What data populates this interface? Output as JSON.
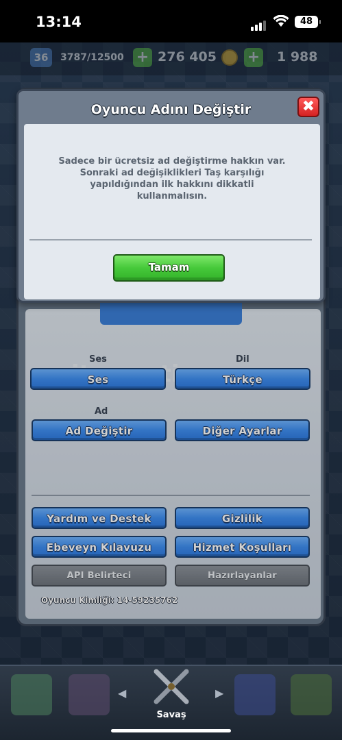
{
  "status_bar": {
    "time": "13:14",
    "battery": "48"
  },
  "resources": {
    "level": "36",
    "xp": "3787/12500",
    "gold": "276 405",
    "gems": "1 988"
  },
  "dialog": {
    "title": "Oyuncu Adını Değiştir",
    "close_label": "✖",
    "message": "Sadece bir ücretsiz ad değiştirme hakkın var. Sonraki ad değişiklikleri Taş karşılığı yapıldığından ilk hakkını dikkatli kullanmalısın.",
    "ok_label": "Tamam"
  },
  "settings": {
    "sound_section": "Ses",
    "sound_button": "Ses",
    "language_section": "Dil",
    "language_button": "Türkçe",
    "name_section": "Ad",
    "change_name_button": "Ad Değiştir",
    "other_settings_button": "Diğer Ayarlar",
    "help_button": "Yardım ve Destek",
    "privacy_button": "Gizlilik",
    "parent_guide_button": "Ebeveyn Kılavuzu",
    "terms_button": "Hizmet Koşulları",
    "api_button": "API Belirteci",
    "credits_button": "Hazırlayanlar",
    "player_id": "Oyuncu Kimliği: 14-59235762"
  },
  "watermark": "itemsatis",
  "bottom_nav": {
    "battle_label": "Savaş"
  },
  "colors": {
    "blue_button": "#3f8ef0",
    "green_button": "#46c93a",
    "close_red": "#d42222",
    "gray_button": "#6e747c"
  }
}
